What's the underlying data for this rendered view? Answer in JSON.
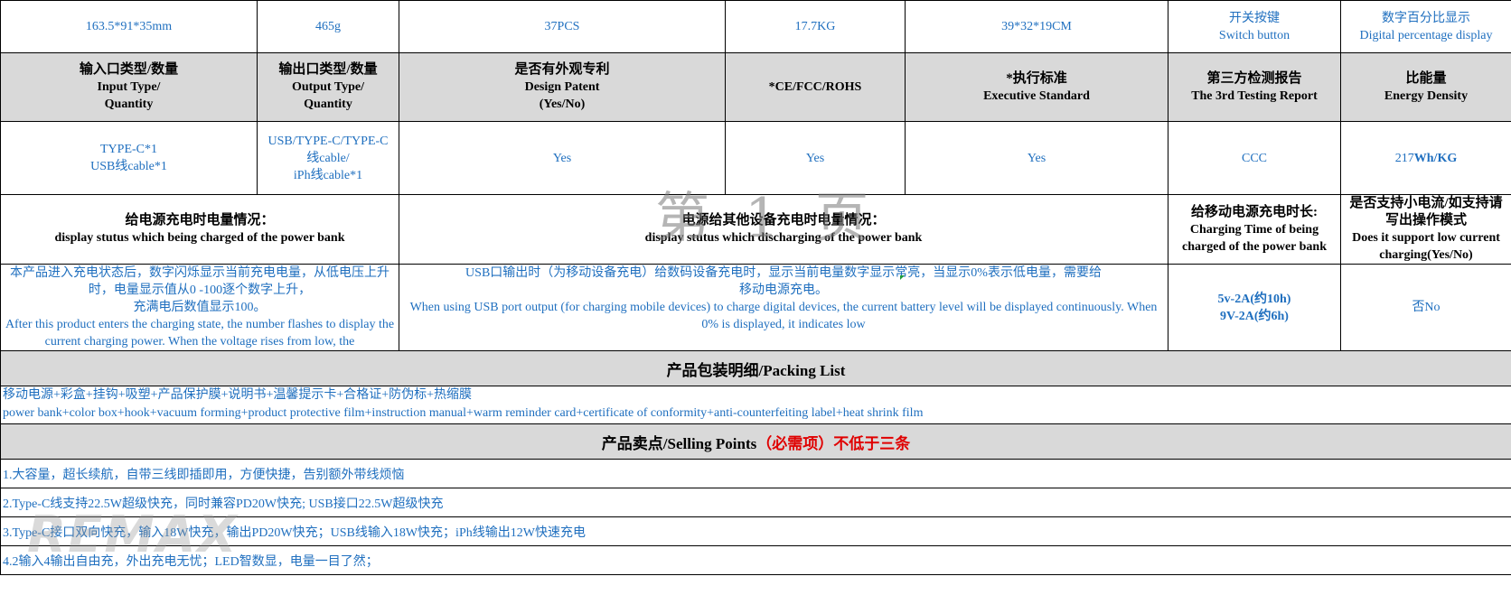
{
  "row1": {
    "size": "163.5*91*35mm",
    "weight": "465g",
    "qty": "37PCS",
    "box_weight": "17.7KG",
    "box_size": "39*32*19CM",
    "switch_cn": "开关按键",
    "switch_en": "Switch button",
    "display_cn": "数字百分比显示",
    "display_en": "Digital percentage display"
  },
  "header2": {
    "input_cn": "输入口类型/数量",
    "input_en1": "Input Type/",
    "input_en2": "Quantity",
    "output_cn": "输出口类型/数量",
    "output_en1": "Output Type/",
    "output_en2": "Quantity",
    "patent_cn": "是否有外观专利",
    "patent_en1": "Design Patent",
    "patent_en2": "(Yes/No)",
    "ce": "*CE/FCC/ROHS",
    "exec_cn": "*执行标准",
    "exec_en": "Executive Standard",
    "report_cn": "第三方检测报告",
    "report_en": "The 3rd Testing Report",
    "energy_cn": "比能量",
    "energy_en": "Energy Density"
  },
  "row3": {
    "input_1": "TYPE-C*1",
    "input_2": "USB线cable*1",
    "output_1": "USB/TYPE-C/TYPE-C",
    "output_2": "线cable/",
    "output_3": "iPh线cable*1",
    "patent": "Yes",
    "ce": "Yes",
    "exec": "Yes",
    "report": "CCC",
    "energy_num": "217",
    "energy_unit": "Wh/KG"
  },
  "header4": {
    "charged_cn": "给电源充电时电量情况：",
    "charged_en": "display stutus which being charged of the power bank",
    "discharging_cn": "电源给其他设备充电时电量情况：",
    "discharging_en": "display stutus which discharging of the power bank",
    "time_cn": "给移动电源充电时长:",
    "time_en": "Charging Time of being charged of the power bank",
    "low_cn": "是否支持小电流/如支持请写出操作模式",
    "low_en": "Does it support low current charging(Yes/No)"
  },
  "row5": {
    "charged_cn1": "本产品进入充电状态后，数字闪烁显示当前充电电量，从低电压上升时，电量显示值从0 -100逐个数字上升，",
    "charged_cn2": "充满电后数值显示100。",
    "charged_en": "After this product enters the charging state, the number flashes to display the current charging power. When the voltage rises from low, the",
    "discharging_cn1": "USB口输出时（为移动设备充电）给数码设备充电时，显示当前电量数字显示常亮，当显示0%表示低电量，需要给",
    "discharging_cn2": "移动电源充电。",
    "discharging_en": "When using USB port output (for charging mobile devices) to charge digital devices, the current battery level will be displayed continuously. When 0% is displayed, it indicates low",
    "time_1": "5v-2A(约10h)",
    "time_2": "9V-2A(约6h)",
    "low": "否No"
  },
  "packing": {
    "title": "产品包装明细/Packing List",
    "cn": "移动电源+彩盒+挂钩+吸塑+产品保护膜+说明书+温馨提示卡+合格证+防伪标+热缩膜",
    "en": "power bank+color box+hook+vacuum forming+product protective film+instruction manual+warm reminder card+certificate of conformity+anti-counterfeiting label+heat shrink film"
  },
  "selling": {
    "title": "产品卖点/Selling Points",
    "required": "（必需项）不低于三条",
    "points": [
      "1.大容量，超长续航，自带三线即插即用，方便快捷，告别额外带线烦恼",
      "2.Type-C线支持22.5W超级快充，同时兼容PD20W快充; USB接口22.5W超级快充",
      "3.Type-C接口双向快充，输入18W快充，输出PD20W快充；USB线输入18W快充；iPh线输出12W快速充电",
      "4.2输入4输出自由充，外出充电无忧；LED智数显，电量一目了然；"
    ]
  },
  "watermarks": {
    "page": "第 1 页",
    "brand": "REMAX"
  },
  "colors": {
    "text_blue": "#1f6fbf",
    "header_gray": "#d9d9d9",
    "required_red": "#e00000"
  }
}
